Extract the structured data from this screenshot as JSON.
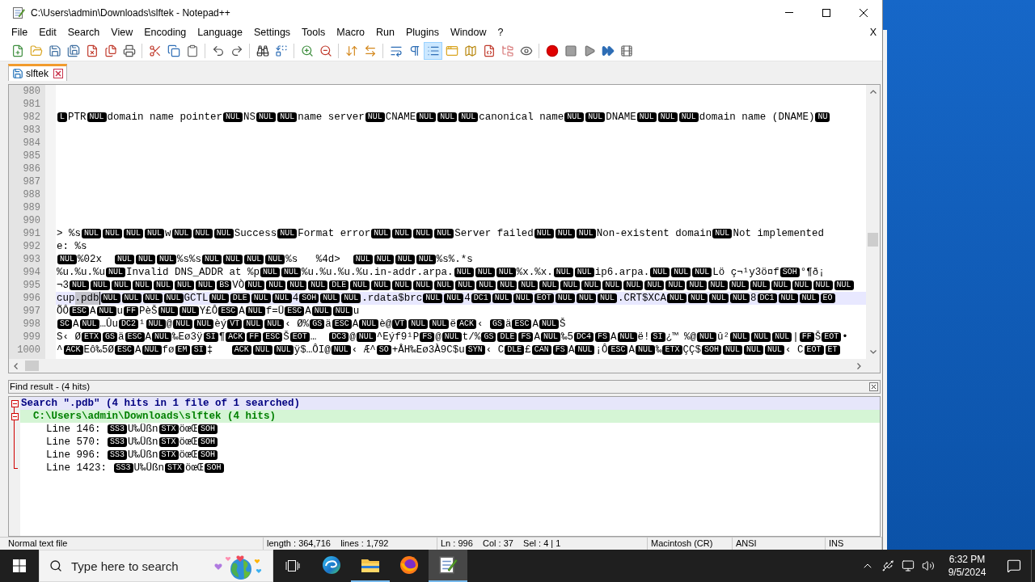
{
  "window": {
    "title": "C:\\Users\\admin\\Downloads\\slftek - Notepad++"
  },
  "menu": [
    "File",
    "Edit",
    "Search",
    "View",
    "Encoding",
    "Language",
    "Settings",
    "Tools",
    "Macro",
    "Run",
    "Plugins",
    "Window",
    "?"
  ],
  "menu_close": "X",
  "toolbar": [
    {
      "pressed": false
    },
    {
      "pressed": false
    },
    {
      "pressed": false
    },
    {
      "pressed": false
    },
    {
      "pressed": false
    },
    {
      "pressed": false
    },
    {
      "pressed": false
    },
    {
      "pressed": false
    },
    {
      "pressed": false
    },
    {
      "pressed": false
    },
    {
      "pressed": false
    },
    {
      "pressed": false
    },
    {
      "pressed": false
    },
    {
      "pressed": false
    },
    {
      "pressed": false
    },
    {
      "pressed": false
    },
    {
      "pressed": false
    },
    {
      "pressed": false
    },
    {
      "pressed": false
    },
    {
      "pressed": false
    },
    {
      "pressed": true
    },
    {
      "pressed": false
    },
    {
      "pressed": false
    },
    {
      "pressed": false
    },
    {
      "pressed": false
    },
    {
      "pressed": false
    },
    {
      "pressed": false
    },
    {
      "pressed": false
    },
    {
      "pressed": false
    },
    {
      "pressed": false
    },
    {
      "pressed": false
    }
  ],
  "tabs": [
    {
      "label": "slftek",
      "selected": true
    }
  ],
  "editor": {
    "lines": [
      {
        "number": "980",
        "current": false
      },
      {
        "number": "981",
        "current": false
      },
      {
        "number": "982",
        "current": false,
        "segments": [
          {
            "kind": "control",
            "codes": [
              "L"
            ]
          },
          {
            "kind": "text",
            "text": "PTR"
          },
          {
            "kind": "control",
            "codes": [
              "NUL"
            ]
          },
          {
            "kind": "text",
            "text": "domain name pointer"
          },
          {
            "kind": "control",
            "codes": [
              "NUL"
            ]
          },
          {
            "kind": "text",
            "text": "NS"
          },
          {
            "kind": "control",
            "codes": [
              "NUL",
              "NUL"
            ]
          },
          {
            "kind": "text",
            "text": "name server"
          },
          {
            "kind": "control",
            "codes": [
              "NUL"
            ]
          },
          {
            "kind": "text",
            "text": "CNAME"
          },
          {
            "kind": "control",
            "codes": [
              "NUL",
              "NUL",
              "NUL"
            ]
          },
          {
            "kind": "text",
            "text": "canonical name"
          },
          {
            "kind": "control",
            "codes": [
              "NUL",
              "NUL"
            ]
          },
          {
            "kind": "text",
            "text": "DNAME"
          },
          {
            "kind": "control",
            "codes": [
              "NUL",
              "NUL",
              "NUL"
            ]
          },
          {
            "kind": "text",
            "text": "domain name (DNAME)"
          },
          {
            "kind": "control",
            "codes": [
              "NU"
            ]
          }
        ]
      },
      {
        "number": "983",
        "current": false
      },
      {
        "number": "984",
        "current": false
      },
      {
        "number": "985",
        "current": false
      },
      {
        "number": "986",
        "current": false
      },
      {
        "number": "987",
        "current": false
      },
      {
        "number": "988",
        "current": false
      },
      {
        "number": "989",
        "current": false
      },
      {
        "number": "990",
        "current": false
      },
      {
        "number": "991",
        "current": false,
        "segments": [
          {
            "kind": "text",
            "text": "> %s"
          },
          {
            "kind": "control",
            "codes": [
              "NUL",
              "NUL",
              "NUL",
              "NUL"
            ]
          },
          {
            "kind": "text",
            "text": "w"
          },
          {
            "kind": "control",
            "codes": [
              "NUL",
              "NUL",
              "NUL"
            ]
          },
          {
            "kind": "text",
            "text": "Success"
          },
          {
            "kind": "control",
            "codes": [
              "NUL"
            ]
          },
          {
            "kind": "text",
            "text": "Format error"
          },
          {
            "kind": "control",
            "codes": [
              "NUL",
              "NUL",
              "NUL",
              "NUL"
            ]
          },
          {
            "kind": "text",
            "text": "Server failed"
          },
          {
            "kind": "control",
            "codes": [
              "NUL",
              "NUL",
              "NUL"
            ]
          },
          {
            "kind": "text",
            "text": "Non-existent domain"
          },
          {
            "kind": "control",
            "codes": [
              "NUL"
            ]
          },
          {
            "kind": "text",
            "text": "Not implemented"
          }
        ]
      },
      {
        "number": "992",
        "current": false,
        "segments": [
          {
            "kind": "text",
            "text": "e: %s"
          }
        ]
      },
      {
        "number": "993",
        "current": false,
        "segments": [
          {
            "kind": "control",
            "codes": [
              "NUL"
            ]
          },
          {
            "kind": "text",
            "text": "%02x  "
          },
          {
            "kind": "control",
            "codes": [
              "NUL",
              "NUL",
              "NUL"
            ]
          },
          {
            "kind": "text",
            "text": "%s%s"
          },
          {
            "kind": "control",
            "codes": [
              "NUL",
              "NUL",
              "NUL",
              "NUL"
            ]
          },
          {
            "kind": "text",
            "text": "%s   %4d>  "
          },
          {
            "kind": "control",
            "codes": [
              "NUL",
              "NUL",
              "NUL",
              "NUL"
            ]
          },
          {
            "kind": "text",
            "text": "%s%.*s"
          }
        ]
      },
      {
        "number": "994",
        "current": false,
        "segments": [
          {
            "kind": "text",
            "text": "%u.%u.%u"
          },
          {
            "kind": "control",
            "codes": [
              "NUL"
            ]
          },
          {
            "kind": "text",
            "text": "Invalid DNS_ADDR at %p"
          },
          {
            "kind": "control",
            "codes": [
              "NUL",
              "NUL"
            ]
          },
          {
            "kind": "text",
            "text": "%u.%u.%u.%u.in-addr.arpa."
          },
          {
            "kind": "control",
            "codes": [
              "NUL",
              "NUL",
              "NUL"
            ]
          },
          {
            "kind": "text",
            "text": "%x.%x."
          },
          {
            "kind": "control",
            "codes": [
              "NUL",
              "NUL"
            ]
          },
          {
            "kind": "text",
            "text": "ip6.arpa."
          },
          {
            "kind": "control",
            "codes": [
              "NUL",
              "NUL",
              "NUL"
            ]
          },
          {
            "kind": "text",
            "text": "Lö ç¬¹y3ö¤f"
          },
          {
            "kind": "control",
            "codes": [
              "SOH"
            ]
          },
          {
            "kind": "text",
            "text": "°¶ð¡"
          }
        ]
      },
      {
        "number": "995",
        "current": false,
        "segments": [
          {
            "kind": "text",
            "text": "¬3"
          },
          {
            "kind": "control",
            "codes": [
              "NUL",
              "NUL",
              "NUL",
              "NUL",
              "NUL",
              "NUL",
              "NUL",
              "BS"
            ]
          },
          {
            "kind": "text",
            "text": "VÒ"
          },
          {
            "kind": "control",
            "codes": [
              "NUL",
              "NUL",
              "NUL",
              "NUL",
              "DLE",
              "NUL",
              "NUL",
              "NUL",
              "NUL",
              "NUL",
              "NUL",
              "NUL",
              "NUL",
              "NUL",
              "NUL",
              "NUL",
              "NUL",
              "NUL",
              "NUL",
              "NUL",
              "NUL",
              "NUL",
              "NUL",
              "NUL",
              "NUL",
              "NUL",
              "NUL",
              "NUL",
              "NUL"
            ]
          }
        ]
      },
      {
        "number": "996",
        "current": true,
        "segments": [
          {
            "kind": "text",
            "text": "cup"
          },
          {
            "kind": "selection",
            "text": ".pdb"
          },
          {
            "kind": "control",
            "codes": [
              "NUL",
              "NUL",
              "NUL",
              "NUL"
            ]
          },
          {
            "kind": "text",
            "text": "GCTL"
          },
          {
            "kind": "control",
            "codes": [
              "NUL",
              "DLE",
              "NUL",
              "NUL"
            ]
          },
          {
            "kind": "text",
            "text": "4"
          },
          {
            "kind": "control",
            "codes": [
              "SOH",
              "NUL",
              "NUL"
            ]
          },
          {
            "kind": "text",
            "text": ".rdata$brc"
          },
          {
            "kind": "control",
            "codes": [
              "NUL",
              "NUL"
            ]
          },
          {
            "kind": "text",
            "text": "4"
          },
          {
            "kind": "control",
            "codes": [
              "DC1",
              "NUL",
              "NUL",
              "EOT",
              "NUL",
              "NUL",
              "NUL"
            ]
          },
          {
            "kind": "text",
            "text": ".CRT$XCA"
          },
          {
            "kind": "control",
            "codes": [
              "NUL",
              "NUL",
              "NUL",
              "NUL"
            ]
          },
          {
            "kind": "text",
            "text": "8"
          },
          {
            "kind": "control",
            "codes": [
              "DC1",
              "NUL",
              "NUL",
              "EO"
            ]
          }
        ]
      },
      {
        "number": "997",
        "current": false,
        "segments": [
          {
            "kind": "text",
            "text": "ÕÔ"
          },
          {
            "kind": "control",
            "codes": [
              "ESC"
            ]
          },
          {
            "kind": "text",
            "text": "A"
          },
          {
            "kind": "control",
            "codes": [
              "NUL"
            ]
          },
          {
            "kind": "text",
            "text": "u"
          },
          {
            "kind": "control",
            "codes": [
              "FF"
            ]
          },
          {
            "kind": "text",
            "text": "PèŠ"
          },
          {
            "kind": "control",
            "codes": [
              "NUL",
              "NUL"
            ]
          },
          {
            "kind": "text",
            "text": "Y£Ô"
          },
          {
            "kind": "control",
            "codes": [
              "ESC"
            ]
          },
          {
            "kind": "text",
            "text": "A"
          },
          {
            "kind": "control",
            "codes": [
              "NUL"
            ]
          },
          {
            "kind": "text",
            "text": "f=Ü"
          },
          {
            "kind": "control",
            "codes": [
              "ESC"
            ]
          },
          {
            "kind": "text",
            "text": "A"
          },
          {
            "kind": "control",
            "codes": [
              "NUL",
              "NUL"
            ]
          },
          {
            "kind": "text",
            "text": "u"
          }
        ]
      },
      {
        "number": "998",
        "current": false,
        "segments": [
          {
            "kind": "control",
            "codes": [
              "SC"
            ]
          },
          {
            "kind": "text",
            "text": "A"
          },
          {
            "kind": "control",
            "codes": [
              "NUL"
            ]
          },
          {
            "kind": "text",
            "text": "…Ûu"
          },
          {
            "kind": "control",
            "codes": [
              "DC2"
            ]
          },
          {
            "kind": "text",
            "text": "¹"
          },
          {
            "kind": "control",
            "codes": [
              "NUL"
            ]
          },
          {
            "kind": "text",
            "text": "@"
          },
          {
            "kind": "control",
            "codes": [
              "NUL",
              "NUL"
            ]
          },
          {
            "kind": "text",
            "text": "èý"
          },
          {
            "kind": "control",
            "codes": [
              "VT",
              "NUL",
              "NUL"
            ]
          },
          {
            "kind": "text",
            "text": "‹ Ø%"
          },
          {
            "kind": "control",
            "codes": [
              "GS"
            ]
          },
          {
            "kind": "text",
            "text": "ä"
          },
          {
            "kind": "control",
            "codes": [
              "ESC"
            ]
          },
          {
            "kind": "text",
            "text": "A"
          },
          {
            "kind": "control",
            "codes": [
              "NUL"
            ]
          },
          {
            "kind": "text",
            "text": "è@"
          },
          {
            "kind": "control",
            "codes": [
              "VT",
              "NUL",
              "NUL"
            ]
          },
          {
            "kind": "text",
            "text": "ë"
          },
          {
            "kind": "control",
            "codes": [
              "ACK"
            ]
          },
          {
            "kind": "text",
            "text": "‹ "
          },
          {
            "kind": "control",
            "codes": [
              "GS"
            ]
          },
          {
            "kind": "text",
            "text": "ä"
          },
          {
            "kind": "control",
            "codes": [
              "ESC"
            ]
          },
          {
            "kind": "text",
            "text": "A"
          },
          {
            "kind": "control",
            "codes": [
              "NUL"
            ]
          },
          {
            "kind": "text",
            "text": "Š"
          }
        ]
      },
      {
        "number": "999",
        "current": false,
        "segments": [
          {
            "kind": "text",
            "text": "S‹ Ø"
          },
          {
            "kind": "control",
            "codes": [
              "ETX",
              "GS"
            ]
          },
          {
            "kind": "text",
            "text": "ä"
          },
          {
            "kind": "control",
            "codes": [
              "ESC"
            ]
          },
          {
            "kind": "text",
            "text": "A"
          },
          {
            "kind": "control",
            "codes": [
              "NUL"
            ]
          },
          {
            "kind": "text",
            "text": "‰Eø3ÿ"
          },
          {
            "kind": "control",
            "codes": [
              "SI"
            ]
          },
          {
            "kind": "text",
            "text": "¶"
          },
          {
            "kind": "control",
            "codes": [
              "ACK",
              "FF",
              "ESC"
            ]
          },
          {
            "kind": "text",
            "text": "Š"
          },
          {
            "kind": "control",
            "codes": [
              "EOT"
            ]
          },
          {
            "kind": "text",
            "text": "…  "
          },
          {
            "kind": "control",
            "codes": [
              "DC3"
            ]
          },
          {
            "kind": "text",
            "text": "@"
          },
          {
            "kind": "control",
            "codes": [
              "NUL"
            ]
          },
          {
            "kind": "text",
            "text": "^Eýf9¹P"
          },
          {
            "kind": "control",
            "codes": [
              "FS"
            ]
          },
          {
            "kind": "text",
            "text": "@"
          },
          {
            "kind": "control",
            "codes": [
              "NUL"
            ]
          },
          {
            "kind": "text",
            "text": "t/%"
          },
          {
            "kind": "control",
            "codes": [
              "GS",
              "DLE",
              "FS"
            ]
          },
          {
            "kind": "text",
            "text": "A"
          },
          {
            "kind": "control",
            "codes": [
              "NUL"
            ]
          },
          {
            "kind": "text",
            "text": "‰5"
          },
          {
            "kind": "control",
            "codes": [
              "DC4",
              "FS"
            ]
          },
          {
            "kind": "text",
            "text": "A"
          },
          {
            "kind": "control",
            "codes": [
              "NUL"
            ]
          },
          {
            "kind": "text",
            "text": "ë!"
          },
          {
            "kind": "control",
            "codes": [
              "SI"
            ]
          },
          {
            "kind": "text",
            "text": "¿™ %@"
          },
          {
            "kind": "control",
            "codes": [
              "NUL"
            ]
          },
          {
            "kind": "text",
            "text": "û²"
          },
          {
            "kind": "control",
            "codes": [
              "NUL",
              "NUL",
              "NUL"
            ]
          },
          {
            "kind": "text",
            "text": "|"
          },
          {
            "kind": "control",
            "codes": [
              "FF"
            ]
          },
          {
            "kind": "text",
            "text": "Š"
          },
          {
            "kind": "control",
            "codes": [
              "EOT"
            ]
          },
          {
            "kind": "text",
            "text": "•"
          }
        ]
      },
      {
        "number": "1000",
        "current": false,
        "segments": [
          {
            "kind": "text",
            "text": "^"
          },
          {
            "kind": "control",
            "codes": [
              "ACK"
            ]
          },
          {
            "kind": "text",
            "text": "Eô‰5Ø"
          },
          {
            "kind": "control",
            "codes": [
              "ESC"
            ]
          },
          {
            "kind": "text",
            "text": "A"
          },
          {
            "kind": "control",
            "codes": [
              "NUL"
            ]
          },
          {
            "kind": "text",
            "text": "fø"
          },
          {
            "kind": "control",
            "codes": [
              "EM",
              "SI"
            ]
          },
          {
            "kind": "text",
            "text": "‡   "
          },
          {
            "kind": "control",
            "codes": [
              "ACK",
              "NUL",
              "NUL"
            ]
          },
          {
            "kind": "text",
            "text": "ÿ$…ÔI@"
          },
          {
            "kind": "control",
            "codes": [
              "NUL"
            ]
          },
          {
            "kind": "text",
            "text": "‹ Æ^"
          },
          {
            "kind": "control",
            "codes": [
              "SO"
            ]
          },
          {
            "kind": "text",
            "text": "+ÅH‰Eø3À9C$u"
          },
          {
            "kind": "control",
            "codes": [
              "SYN"
            ]
          },
          {
            "kind": "text",
            "text": "‹ C"
          },
          {
            "kind": "control",
            "codes": [
              "DLE"
            ]
          },
          {
            "kind": "text",
            "text": "£"
          },
          {
            "kind": "control",
            "codes": [
              "CAN",
              "FS"
            ]
          },
          {
            "kind": "text",
            "text": "A"
          },
          {
            "kind": "control",
            "codes": [
              "NUL"
            ]
          },
          {
            "kind": "text",
            "text": "¡Ô"
          },
          {
            "kind": "control",
            "codes": [
              "ESC"
            ]
          },
          {
            "kind": "text",
            "text": "A"
          },
          {
            "kind": "control",
            "codes": [
              "NUL"
            ]
          },
          {
            "kind": "text",
            "text": "‰"
          },
          {
            "kind": "control",
            "codes": [
              "ETX"
            ]
          },
          {
            "kind": "text",
            "text": "ÇÇ$"
          },
          {
            "kind": "control",
            "codes": [
              "SOH",
              "NUL",
              "NUL",
              "NUL"
            ]
          },
          {
            "kind": "text",
            "text": "‹ C"
          },
          {
            "kind": "control",
            "codes": [
              "EOT",
              "ET"
            ]
          }
        ]
      }
    ]
  },
  "find_results": {
    "title": "Find result - (4 hits)",
    "lines": [
      {
        "kind": "search",
        "text": "Search \".pdb\" (4 hits in 1 file of 1 searched)",
        "expanded": true
      },
      {
        "kind": "file",
        "text": "C:\\Users\\admin\\Downloads\\slftek (4 hits)",
        "expanded": true
      },
      {
        "kind": "hit",
        "label": "Line 146:",
        "segments": [
          {
            "kind": "control",
            "codes": [
              "SS3"
            ]
          },
          {
            "kind": "text",
            "text": "U‰Üßn"
          },
          {
            "kind": "control",
            "codes": [
              "STX"
            ]
          },
          {
            "kind": "text",
            "text": "öœŒ"
          },
          {
            "kind": "control",
            "codes": [
              "SOH"
            ]
          }
        ]
      },
      {
        "kind": "hit",
        "label": "Line 570:",
        "segments": [
          {
            "kind": "control",
            "codes": [
              "SS3"
            ]
          },
          {
            "kind": "text",
            "text": "U‰Üßn"
          },
          {
            "kind": "control",
            "codes": [
              "STX"
            ]
          },
          {
            "kind": "text",
            "text": "öœŒ"
          },
          {
            "kind": "control",
            "codes": [
              "SOH"
            ]
          }
        ]
      },
      {
        "kind": "hit",
        "label": "Line 996:",
        "segments": [
          {
            "kind": "control",
            "codes": [
              "SS3"
            ]
          },
          {
            "kind": "text",
            "text": "U‰Üßn"
          },
          {
            "kind": "control",
            "codes": [
              "STX"
            ]
          },
          {
            "kind": "text",
            "text": "öœŒ"
          },
          {
            "kind": "control",
            "codes": [
              "SOH"
            ]
          }
        ]
      },
      {
        "kind": "hit",
        "label": "Line 1423:",
        "segments": [
          {
            "kind": "control",
            "codes": [
              "SS3"
            ]
          },
          {
            "kind": "text",
            "text": "U‰Üßn"
          },
          {
            "kind": "control",
            "codes": [
              "STX"
            ]
          },
          {
            "kind": "text",
            "text": "öœŒ"
          },
          {
            "kind": "control",
            "codes": [
              "SOH"
            ]
          }
        ]
      }
    ]
  },
  "status_bar": [
    "Normal text file",
    "length : 364,716    lines : 1,792",
    "Ln : 996    Col : 37    Sel : 4 | 1",
    "Macintosh (CR)",
    "ANSI",
    "INS"
  ],
  "taskbar": {
    "search": {
      "placeholder": "Type here to search"
    },
    "apps": [
      {
        "kind": "swirl",
        "running": false,
        "active": false
      },
      {
        "kind": "folder",
        "running": true,
        "active": false
      },
      {
        "kind": "fox",
        "running": false,
        "active": false
      },
      {
        "kind": "notepad",
        "running": true,
        "active": true
      }
    ],
    "time": "6:32 PM",
    "date": "9/5/2024"
  }
}
